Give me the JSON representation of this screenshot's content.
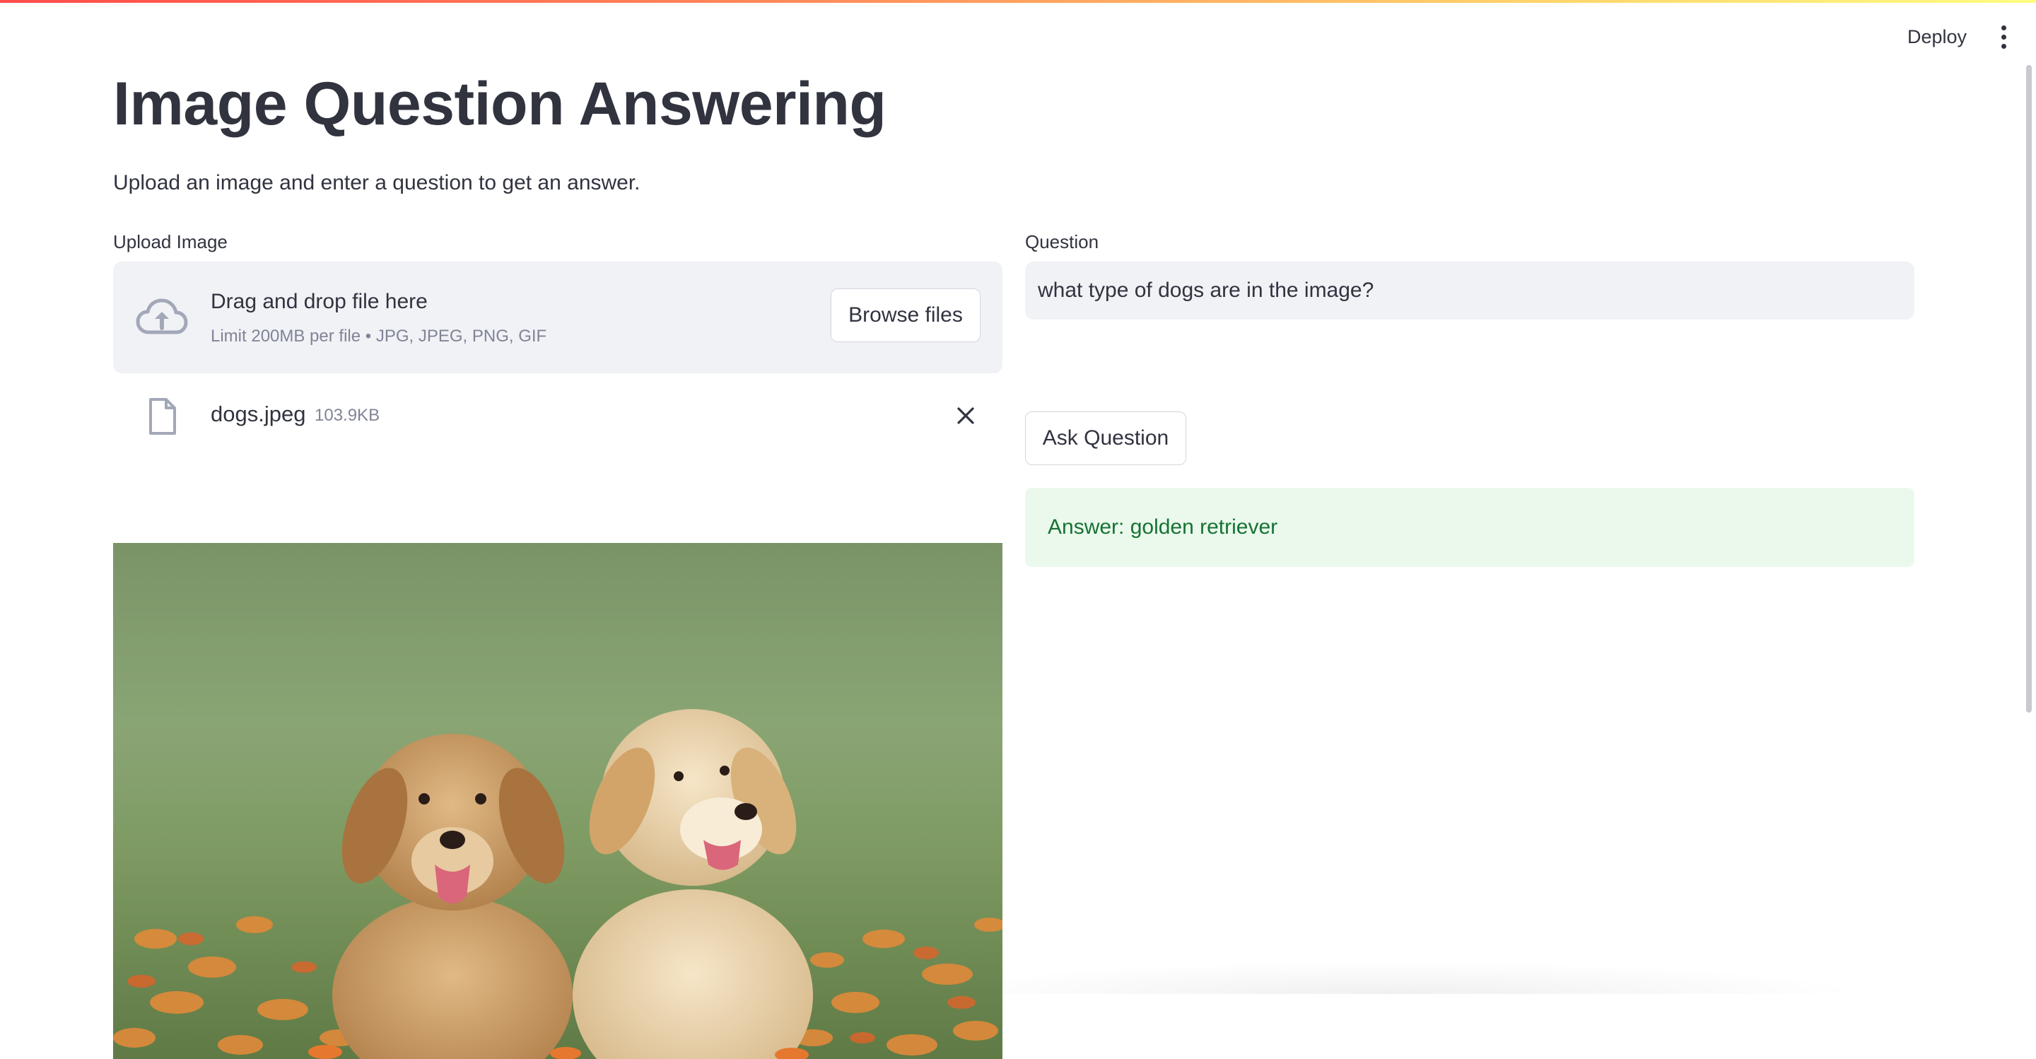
{
  "header": {
    "deploy_label": "Deploy",
    "menu_icon": "kebab-menu-icon"
  },
  "page": {
    "title": "Image Question Answering",
    "subtitle": "Upload an image and enter a question to get an answer."
  },
  "upload": {
    "label": "Upload Image",
    "dropzone_title": "Drag and drop file here",
    "dropzone_hint": "Limit 200MB per file • JPG, JPEG, PNG, GIF",
    "browse_label": "Browse files",
    "file": {
      "name": "dogs.jpeg",
      "size": "103.9KB"
    },
    "icons": {
      "upload": "cloud-upload-icon",
      "file": "file-icon",
      "remove": "close-icon"
    }
  },
  "question": {
    "label": "Question",
    "value": "what type of dogs are in the image?",
    "ask_label": "Ask Question",
    "answer": "Answer: golden retriever"
  },
  "colors": {
    "accent_red": "#ff4b4b",
    "text": "#31333f",
    "muted": "#808495",
    "input_bg": "#f0f2f6",
    "success_bg": "#eaf9ec",
    "success_text": "#177233"
  }
}
